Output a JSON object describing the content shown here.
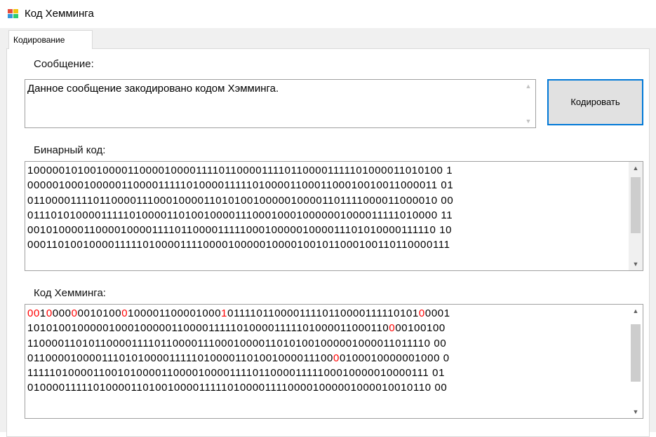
{
  "window": {
    "title": "Код Хемминга",
    "icon": "app-window-icon"
  },
  "tabs": [
    {
      "label": "Кодирование",
      "selected": true
    }
  ],
  "message": {
    "label": "Сообщение:",
    "value": "Данное сообщение закодировано кодом Хэмминга."
  },
  "encode_button": {
    "label": "Кодировать"
  },
  "binary": {
    "label": "Бинарный код:",
    "lines": [
      "10000010100100001100001000011110110000111101100001111101000011010100 1",
      "0000010001000001100001111101000011111010000110001100010010011000011 01",
      "0110000111101100001110001000011010100100000100001101111000011000010 00",
      "0111010100001111101000011010010000111000100010000001000011111010000 11",
      "0010100001100001000011110110000111110001000001000011101010000111110 10",
      "000110100100001111101000011110000100000100001001011000100110110000111"
    ]
  },
  "hamming": {
    "label": "Код Хемминга:",
    "lines": [
      [
        {
          "t": "00",
          "r": true
        },
        {
          "t": "1",
          "r": false
        },
        {
          "t": "0",
          "r": true
        },
        {
          "t": "000",
          "r": false
        },
        {
          "t": "0",
          "r": true
        },
        {
          "t": "0010100",
          "r": false
        },
        {
          "t": "0",
          "r": true
        },
        {
          "t": "100001100001000",
          "r": false
        },
        {
          "t": "1",
          "r": true
        },
        {
          "t": "01111011000011110110000111110101",
          "r": false
        },
        {
          "t": "0",
          "r": true
        },
        {
          "t": "0001",
          "r": false
        }
      ],
      [
        {
          "t": "10101001000001000100000110000111110100001111101000011000110",
          "r": false
        },
        {
          "t": "0",
          "r": true
        },
        {
          "t": "00100100",
          "r": false
        }
      ],
      [
        {
          "t": "110000110101100001111011000011100010000110101001000001000011011110 00",
          "r": false
        }
      ],
      [
        {
          "t": "01100001000011101010000111110100001101001000011100",
          "r": false
        },
        {
          "t": "0",
          "r": true
        },
        {
          "t": "0100010000001000 0",
          "r": false
        }
      ],
      [
        {
          "t": "111110100001100101000011000010000111101100001111100010000010000111 01",
          "r": false
        }
      ],
      [
        {
          "t": "010000111110100001101001000011111010000111100001000001000010010110 00",
          "r": false
        }
      ]
    ]
  },
  "colors": {
    "accent": "#0078d7",
    "parity_bit": "#ff0000"
  }
}
